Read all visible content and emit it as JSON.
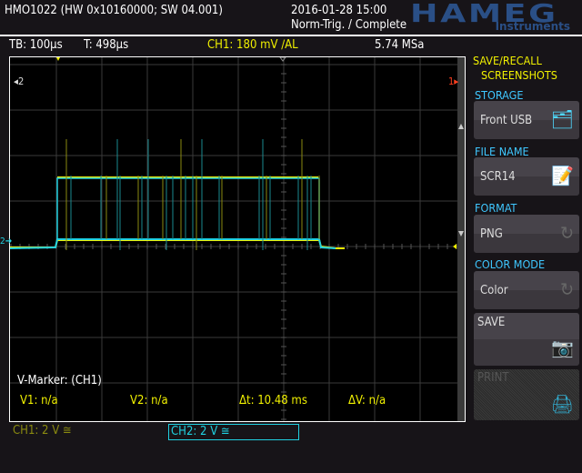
{
  "header": {
    "device": "HMO1022 (HW 0x10160000; SW 04.001)",
    "datetime": "2016-01-28 15:00",
    "status": "Norm-Trig. / Complete",
    "logo": "HAMEG",
    "logo_sub": "Instruments"
  },
  "infobar": {
    "timebase": "TB: 100µs",
    "trigger_time": "T: 498µs",
    "trigger": "CH1: 180 mV ∕AL",
    "sample_rate": "5.74 MSa"
  },
  "plot": {
    "marker_ch2": "2",
    "marker_ch1": "1",
    "ch2_ground": "2"
  },
  "markers": {
    "title": "V-Marker: (CH1)",
    "v1": "V1: n/a",
    "v2": "V2: n/a",
    "dt": "Δt: 10.48 ms",
    "dv": "ΔV: n/a"
  },
  "channels": {
    "ch1": "CH1: 2 V ≅",
    "ch2": "CH2: 2 V ≅"
  },
  "menu": {
    "title1": "SAVE/RECALL",
    "title2": "SCREENSHOTS",
    "storage_label": "STORAGE",
    "storage_value": "Front USB",
    "filename_label": "FILE NAME",
    "filename_value": "SCR14",
    "format_label": "FORMAT",
    "format_value": "PNG",
    "color_label": "COLOR MODE",
    "color_value": "Color",
    "save": "SAVE",
    "print": "PRINT"
  },
  "colors": {
    "ch1": "#f0f000",
    "ch2": "#20d0e0",
    "menu_title": "#3fc7ff"
  }
}
